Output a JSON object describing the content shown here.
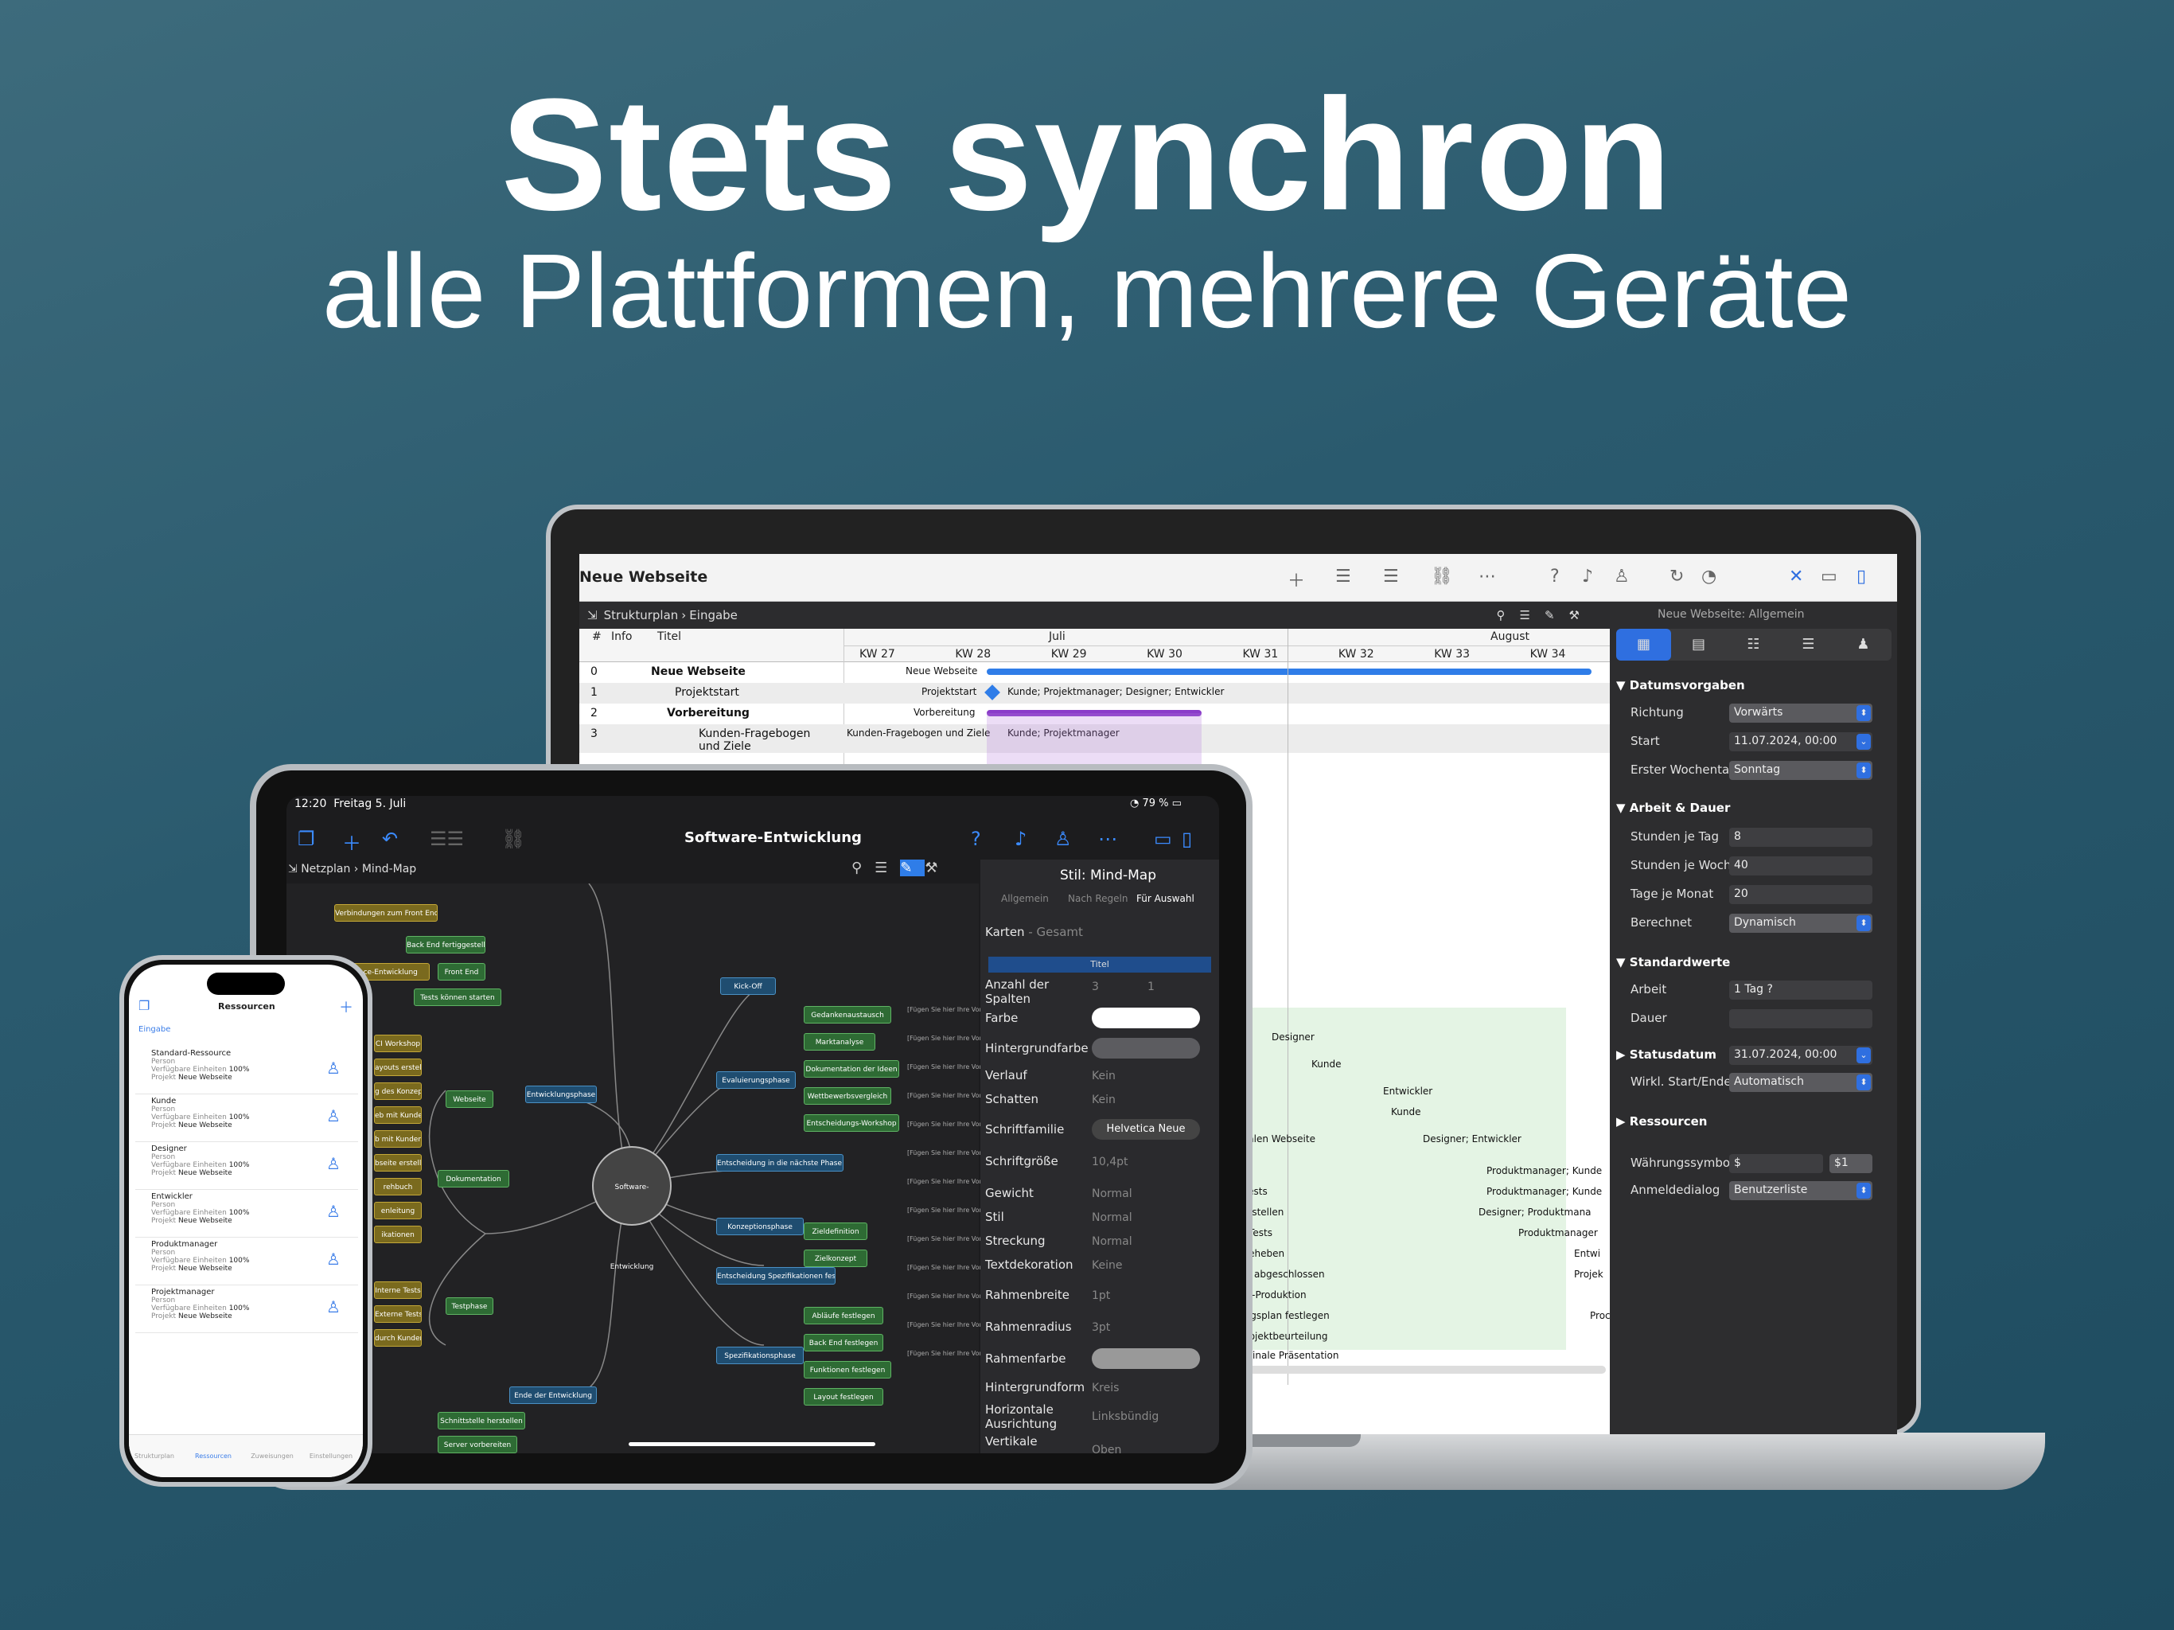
{
  "headline": {
    "title": "Stets synchron",
    "subtitle": "alle Plattformen, mehrere Geräte"
  },
  "mac": {
    "window_title": "Neue Webseite",
    "breadcrumb": [
      "Strukturplan",
      "Eingabe"
    ],
    "inspector_title": "Neue Webseite: Allgemein",
    "columns": {
      "num": "#",
      "info": "Info",
      "title": "Titel"
    },
    "months": [
      "Juli",
      "August"
    ],
    "weeks": [
      "KW 27",
      "KW 28",
      "KW 29",
      "KW 30",
      "KW 31",
      "KW 32",
      "KW 33",
      "KW 34"
    ],
    "rows": [
      {
        "num": "0",
        "title": "Neue Webseite",
        "bar_label": "Neue Webseite"
      },
      {
        "num": "1",
        "title": "Projektstart",
        "bar_label": "Projektstart",
        "resources": "Kunde; Projektmanager; Designer; Entwickler"
      },
      {
        "num": "2",
        "title": "Vorbereitung",
        "bar_label": "Vorbereitung"
      },
      {
        "num": "3",
        "title": "Kunden-Fragebogen und Ziele",
        "bar_label": "Kunden-Fragebogen und Ziele",
        "resources": "Kunde; Projektmanager"
      }
    ],
    "gantt_labels": [
      "Designer",
      "Kunde",
      "Entwickler",
      "Kunde",
      "uktion der finalen Webseite",
      "Designer; Entwickler",
      "Betatest",
      "Produktmanager; Kunde",
      "Usability-Tests",
      "Produktmanager; Kunde",
      "Style Guide erstellen",
      "Designer; Produktmana",
      "Browser-Tests",
      "Produktmanager",
      "Bugs beheben",
      "Entwi",
      "Produktion abgeschlossen",
      "Projek",
      "Post-Produktion",
      "Wartungsplan festlegen",
      "Proc",
      "Projektbeurteilung",
      "Finale Präsentation"
    ],
    "inspector": {
      "sections": {
        "datum": "Datumsvorgaben",
        "arbeit": "Arbeit & Dauer",
        "standard": "Standardwerte",
        "status": "Statusdatum",
        "ressourcen": "Ressourcen"
      },
      "richtung_label": "Richtung",
      "richtung": "Vorwärts",
      "start_label": "Start",
      "start": "11.07.2024, 00:00",
      "wochentag_label": "Erster Wochentag",
      "wochentag": "Sonntag",
      "stunden_tag_label": "Stunden je Tag",
      "stunden_tag": "8",
      "stunden_woche_label": "Stunden je Woche",
      "stunden_woche": "40",
      "tage_monat_label": "Tage je Monat",
      "tage_monat": "20",
      "berechnet_label": "Berechnet",
      "berechnet": "Dynamisch",
      "arbeit_label": "Arbeit",
      "arbeit": "1 Tag ?",
      "dauer_label": "Dauer",
      "statusdatum": "31.07.2024, 00:00",
      "wirkl_label": "Wirkl. Start/Ende",
      "wirkl": "Automatisch",
      "waehrung_label": "Währungssymbol",
      "waehrung": "$",
      "waehrung_btn": "$1",
      "anmelde_label": "Anmeldedialog",
      "anmelde": "Benutzerliste"
    }
  },
  "ipad": {
    "time": "12:20",
    "date": "Freitag 5. Juli",
    "battery": "79 %",
    "title": "Software-Entwicklung",
    "breadcrumb": [
      "Netzplan",
      "Mind-Map"
    ],
    "center_node": "Software-Entwicklung",
    "nodes_blue": [
      "Kick-Off",
      "Entwicklungsphase",
      "Evaluierungsphase",
      "Entscheidung in die nächste Phase einzutreten",
      "Konzeptionsphase",
      "Entscheidung Spezifikationen festzulegen",
      "Spezifikationsphase",
      "Ende der Entwicklung"
    ],
    "nodes_green": [
      "Back End fertiggestellt",
      "Front End",
      "Tests können starten",
      "Webseite",
      "Dokumentation",
      "Testphase",
      "Gedankenaustausch",
      "Marktanalyse",
      "Dokumentation der Ideen",
      "Wettbewerbsvergleich",
      "Entscheidungs-Workshop",
      "Zieldefinition",
      "Zielkonzept",
      "Abläufe festlegen",
      "Back End festlegen",
      "Funktionen festlegen",
      "Layout festlegen",
      "Schnittstelle herstellen",
      "Server vorbereiten"
    ],
    "nodes_olive": [
      "Verbindungen zum Front End herstellen",
      "terface-Entwicklung",
      "CI Workshop",
      "ayouts erstellen",
      "g des Konzepts",
      "eb mit Kunden",
      "b mit Kunden",
      "bseite erstellen",
      "rehbuch",
      "enleitung",
      "ikationen",
      "Interne Tests",
      "Externe Tests",
      "durch Kunden"
    ],
    "hint": "[Fügen Sie hier Ihre Vorgänge ein]",
    "panel": {
      "title": "Stil: Mind-Map",
      "tabs": [
        "Allgemein",
        "Nach Regeln",
        "Für Auswahl"
      ],
      "karten": "Karten",
      "karten_sub": "- Gesamt",
      "titel_col": "Titel",
      "spalten_label": "Anzahl der Spalten",
      "spalten_a": "3",
      "spalten_b": "1",
      "farbe": "Farbe",
      "hintergrundfarbe": "Hintergrundfarbe",
      "verlauf": "Verlauf",
      "verlauf_v": "Kein",
      "schatten": "Schatten",
      "schatten_v": "Kein",
      "schriftfamilie": "Schriftfamilie",
      "schriftfamilie_v": "Helvetica Neue",
      "schriftgroesse": "Schriftgröße",
      "schriftgroesse_v": "10,4pt",
      "gewicht": "Gewicht",
      "gewicht_v": "Normal",
      "stil": "Stil",
      "stil_v": "Normal",
      "streckung": "Streckung",
      "streckung_v": "Normal",
      "textdekoration": "Textdekoration",
      "textdekoration_v": "Keine",
      "rahmenbreite": "Rahmenbreite",
      "rahmenbreite_v": "1pt",
      "rahmenradius": "Rahmenradius",
      "rahmenradius_v": "3pt",
      "rahmenfarbe": "Rahmenfarbe",
      "hintergrundform": "Hintergrundform",
      "hintergrundform_v": "Kreis",
      "horizontale": "Horizontale Ausrichtung",
      "horizontale_v": "Linksbündig",
      "vertikale": "Vertikale",
      "vertikale_v": "Oben"
    }
  },
  "iphone": {
    "title": "Ressourcen",
    "tab": "Eingabe",
    "type": "Person",
    "einheiten_label": "Verfügbare Einheiten",
    "einheiten": "100%",
    "projekt_label": "Projekt",
    "projekt": "Neue Webseite",
    "items": [
      "Standard-Ressource",
      "Kunde",
      "Designer",
      "Entwickler",
      "Produktmanager",
      "Projektmanager"
    ],
    "tabbar": [
      "Strukturplan",
      "Ressourcen",
      "Zuweisungen",
      "Einstellungen"
    ]
  },
  "colors": {
    "accent": "#2f6fe0",
    "background": "#2a5a6e"
  }
}
